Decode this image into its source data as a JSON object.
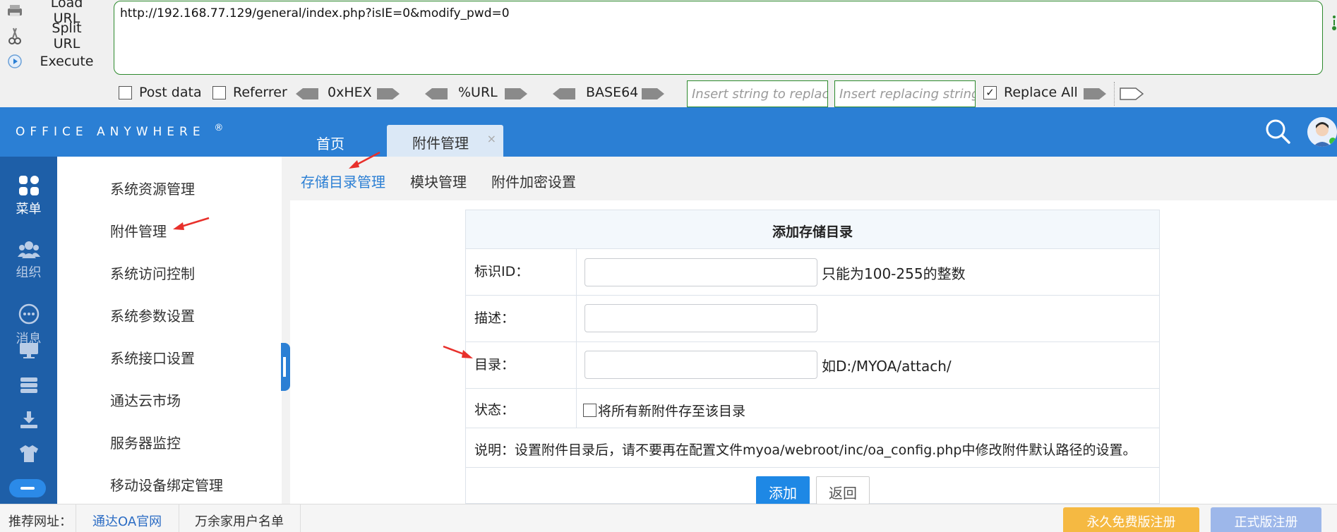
{
  "hackbar": {
    "menu": [
      {
        "label": "Load URL",
        "icon": "load-url-icon"
      },
      {
        "label": "Split URL",
        "icon": "split-url-icon"
      },
      {
        "label": "Execute",
        "icon": "execute-icon"
      }
    ],
    "url_value": "http://192.168.77.129/general/index.php?isIE=0&modify_pwd=0",
    "post_data_label": "Post data",
    "post_data_checked": false,
    "referrer_label": "Referrer",
    "referrer_checked": false,
    "hex_label": "0xHEX",
    "url_label": "%URL",
    "base64_label": "BASE64",
    "replace_input_placeholder": "Insert string to replace",
    "replacing_input_placeholder": "Insert replacing string",
    "replace_all_label": "Replace All",
    "replace_all_checked": true,
    "accent_color": "#2d8a2d"
  },
  "header": {
    "logo_text": "Office Anywhere",
    "logo_mark": "®",
    "tabs": [
      {
        "label": "首页",
        "active": false
      },
      {
        "label": "附件管理",
        "active": true,
        "close": "×"
      }
    ],
    "search_icon": "search-icon",
    "avatar_icon": "user-avatar",
    "brand_color": "#2b7fd4"
  },
  "rail": {
    "items": [
      {
        "label": "菜单",
        "icon": "grid-icon",
        "active": true
      },
      {
        "label": "组织",
        "icon": "people-icon",
        "active": false
      },
      {
        "label": "消息",
        "icon": "chat-icon",
        "active": false
      },
      {
        "label": "",
        "icon": "monitor-icon",
        "active": false
      },
      {
        "label": "",
        "icon": "server-icon",
        "active": false
      },
      {
        "label": "",
        "icon": "download-icon",
        "active": false
      },
      {
        "label": "",
        "icon": "shirt-icon",
        "active": false
      }
    ]
  },
  "menu": {
    "items": [
      "系统资源管理",
      "附件管理",
      "系统访问控制",
      "系统参数设置",
      "系统接口设置",
      "通达云市场",
      "服务器监控",
      "移动设备绑定管理"
    ]
  },
  "subnav": {
    "items": [
      {
        "label": "存储目录管理",
        "active": true
      },
      {
        "label": "模块管理",
        "active": false
      },
      {
        "label": "附件加密设置",
        "active": false
      }
    ]
  },
  "form": {
    "title": "添加存储目录",
    "id_label": "标识ID：",
    "id_value": "",
    "id_hint": "只能为100-255的整数",
    "desc_label": "描述：",
    "desc_value": "",
    "dir_label": "目录：",
    "dir_value": "",
    "dir_hint": "如D:/MYOA/attach/",
    "status_label": "状态：",
    "status_checkbox_label": "将所有新附件存至该目录",
    "status_checked": false,
    "note": "说明：设置附件目录后，请不要再在配置文件myoa/webroot/inc/oa_config.php中修改附件默认路径的设置。",
    "add_button": "添加",
    "back_button": "返回"
  },
  "footer": {
    "label": "推荐网址：",
    "links": [
      "通达OA官网",
      "万余家用户名单"
    ],
    "free_button": "永久免费版注册",
    "pro_button": "正式版注册",
    "free_color": "#f5b942",
    "pro_color": "#9db7ea"
  }
}
